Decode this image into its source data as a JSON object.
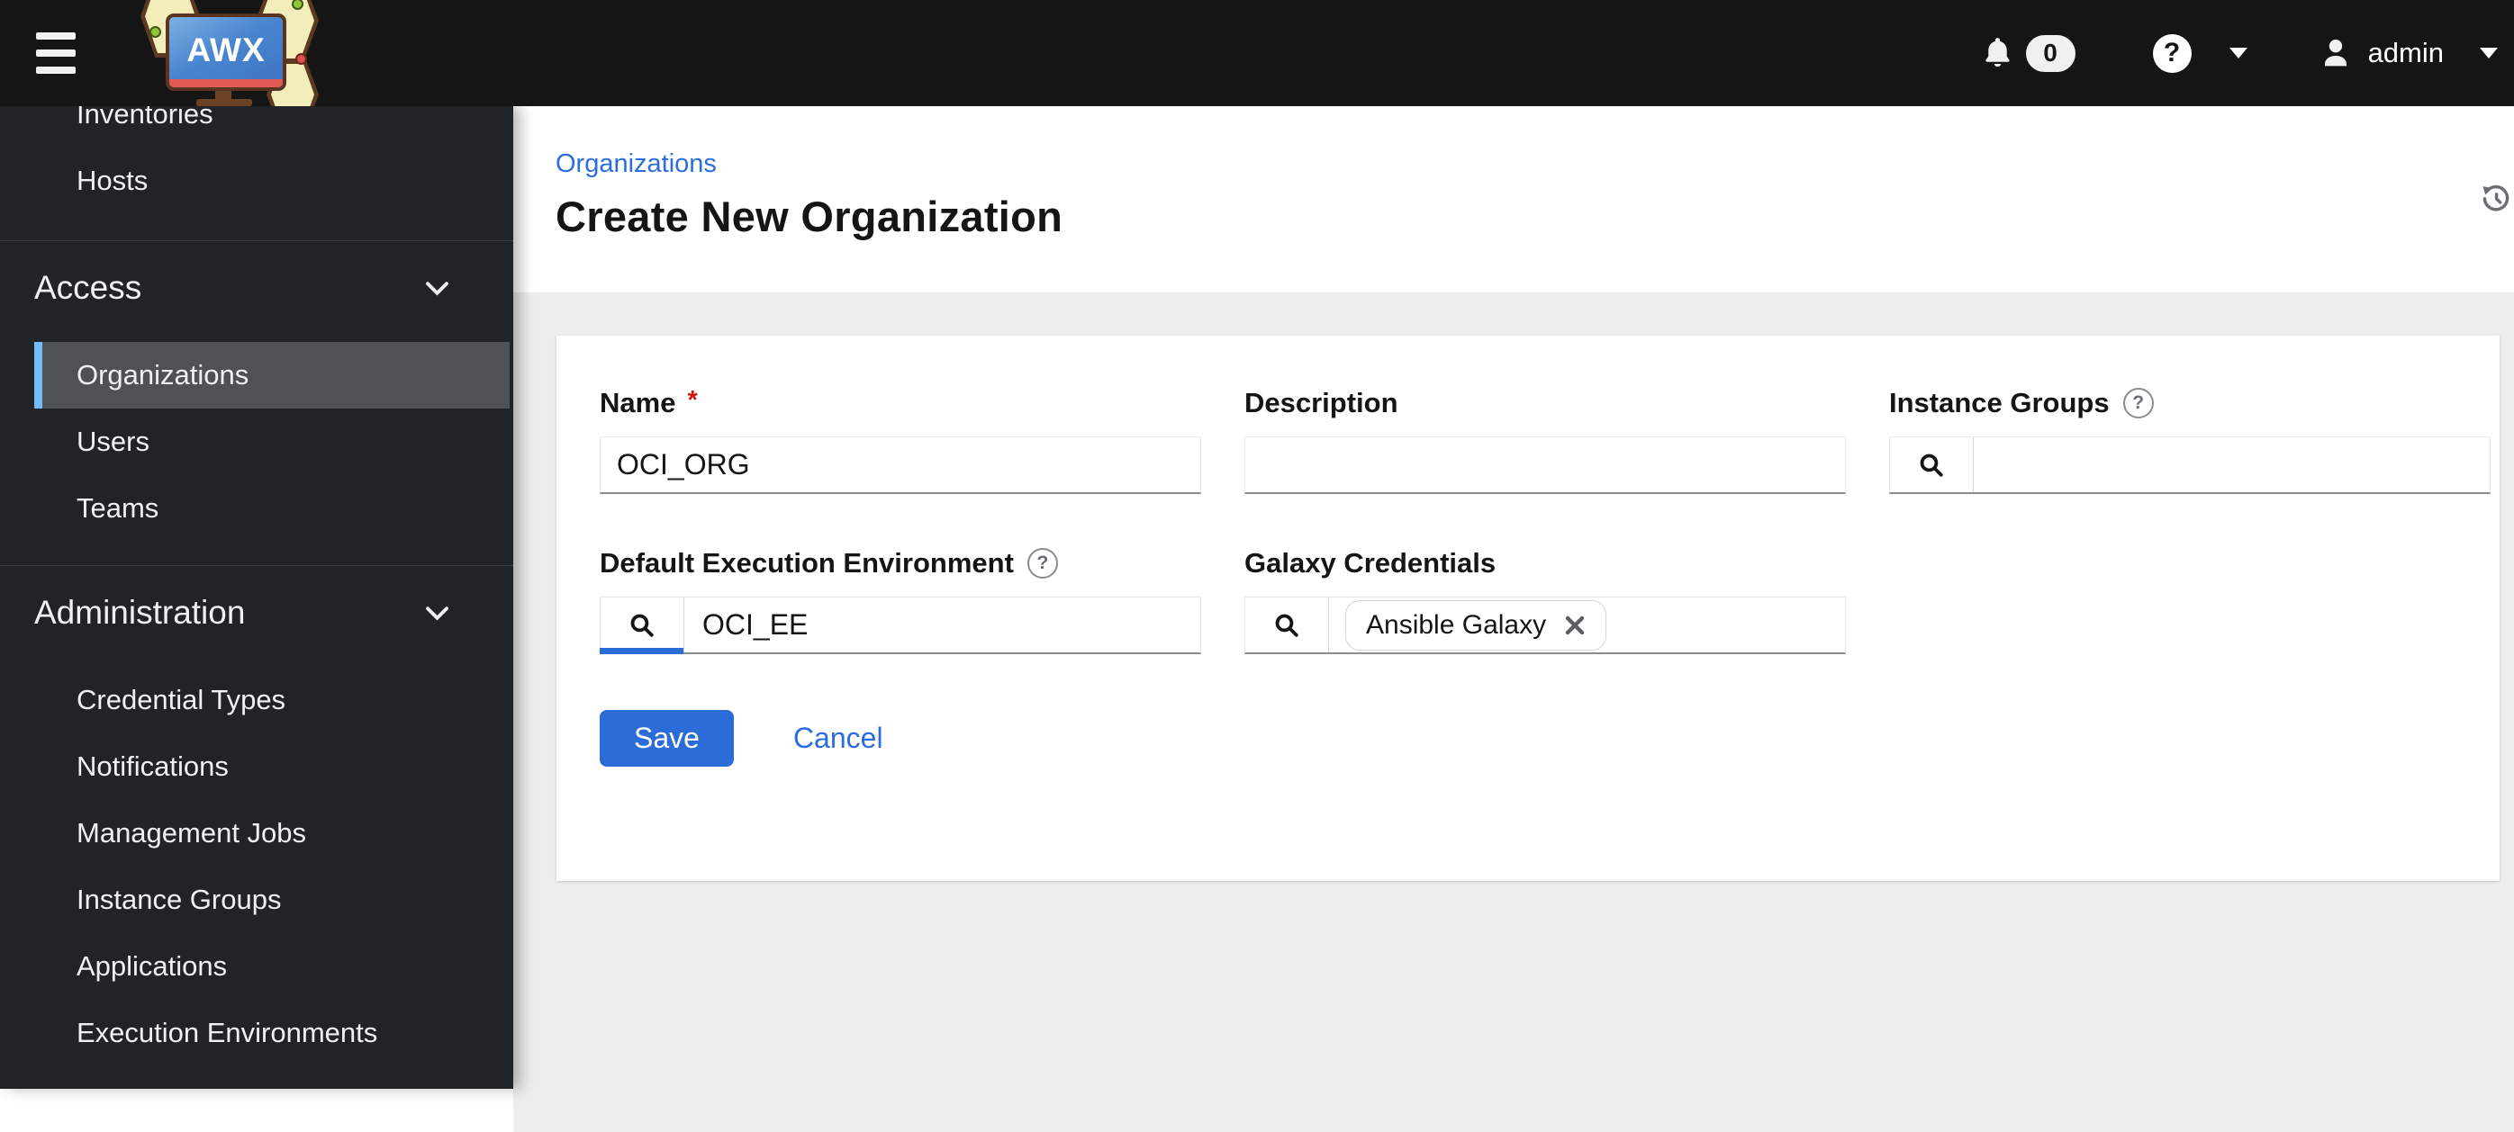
{
  "masthead": {
    "brand": "AWX",
    "notifications_count": "0",
    "user_name": "admin"
  },
  "sidebar": {
    "top_items": [
      {
        "label": "Inventories"
      },
      {
        "label": "Hosts"
      }
    ],
    "sections": [
      {
        "label": "Access",
        "items": [
          {
            "label": "Organizations",
            "selected": true
          },
          {
            "label": "Users",
            "selected": false
          },
          {
            "label": "Teams",
            "selected": false
          }
        ]
      },
      {
        "label": "Administration",
        "items": [
          {
            "label": "Credential Types",
            "selected": false
          },
          {
            "label": "Notifications",
            "selected": false
          },
          {
            "label": "Management Jobs",
            "selected": false
          },
          {
            "label": "Instance Groups",
            "selected": false
          },
          {
            "label": "Applications",
            "selected": false
          },
          {
            "label": "Execution Environments",
            "selected": false
          }
        ]
      }
    ]
  },
  "page": {
    "breadcrumb": "Organizations",
    "title": "Create New Organization"
  },
  "form": {
    "name_field": {
      "label": "Name",
      "required_marker": "*",
      "value": "OCI_ORG"
    },
    "description_field": {
      "label": "Description",
      "value": ""
    },
    "instance_groups_field": {
      "label": "Instance Groups",
      "value": ""
    },
    "default_execution_environment_field": {
      "label": "Default Execution Environment",
      "value": "OCI_EE"
    },
    "galaxy_credentials_field": {
      "label": "Galaxy Credentials",
      "chips": [
        {
          "label": "Ansible Galaxy"
        }
      ]
    },
    "actions": {
      "save_label": "Save",
      "cancel_label": "Cancel"
    }
  },
  "colors": {
    "accent_blue": "#2b6de0",
    "save_blue": "#2b6cd8",
    "nav_selected_bg": "#4f5255",
    "nav_selected_bar": "#73bcf7",
    "masthead_bg": "#151515",
    "sidebar_bg": "#212427",
    "content_bg": "#ededed",
    "required_red": "#c9190b",
    "icon_gray": "#6a6e73"
  }
}
